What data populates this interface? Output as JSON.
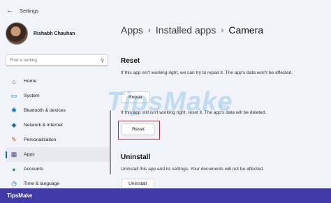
{
  "window": {
    "title": "Settings"
  },
  "profile": {
    "name": "Rishabh Chauhan"
  },
  "search": {
    "placeholder": "Find a setting"
  },
  "sidebar": {
    "items": [
      {
        "label": "Home",
        "icon": "home-icon",
        "glyph": "⌂",
        "color": "#555555",
        "active": false
      },
      {
        "label": "System",
        "icon": "monitor-icon",
        "glyph": "▭",
        "color": "#0078d4",
        "active": false
      },
      {
        "label": "Bluetooth & devices",
        "icon": "bluetooth-icon",
        "glyph": "✱",
        "color": "#0078d4",
        "active": false
      },
      {
        "label": "Network & internet",
        "icon": "wifi-icon",
        "glyph": "◆",
        "color": "#1a6fb5",
        "active": false
      },
      {
        "label": "Personalization",
        "icon": "brush-icon",
        "glyph": "✎",
        "color": "#c05a1a",
        "active": false
      },
      {
        "label": "Apps",
        "icon": "apps-icon",
        "glyph": "▦",
        "color": "#4a4a8a",
        "active": true
      },
      {
        "label": "Accounts",
        "icon": "person-icon",
        "glyph": "●",
        "color": "#1b9e5a",
        "active": false
      },
      {
        "label": "Time & language",
        "icon": "globe-clock-icon",
        "glyph": "◷",
        "color": "#1a6fb5",
        "active": false
      }
    ]
  },
  "breadcrumb": {
    "items": [
      "Apps",
      "Installed apps"
    ],
    "separator": "›",
    "current": "Camera"
  },
  "reset_section": {
    "title": "Reset",
    "repair_desc": "If this app isn't working right, we can try to repair it. The app's data won't be affected.",
    "repair_label": "Repair",
    "reset_desc": "If this app still isn't working right, reset it. The app's data will be deleted.",
    "reset_label": "Reset"
  },
  "uninstall_section": {
    "title": "Uninstall",
    "desc": "Uninstall this app and its settings. Your documents will not be affected.",
    "uninstall_label": "Uninstall"
  },
  "watermark": {
    "text": "TipsMake",
    "sub": ".com"
  },
  "footer": {
    "brand": "TipsMake"
  },
  "colors": {
    "accent": "#0067c0",
    "highlight": "#c0282f",
    "footer_bg": "#3f3aa6"
  }
}
